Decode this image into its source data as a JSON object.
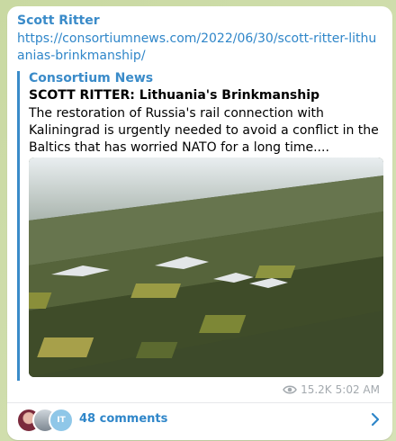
{
  "post": {
    "author": "Scott Ritter",
    "link_text": "https://consortiumnews.com/2022/06/30/scott-ritter-lithuanias-brinkmanship/",
    "preview": {
      "site_name": "Consortium News",
      "title": "SCOTT RITTER: Lithuania's Brinkmanship",
      "description": "The restoration of Russia's rail connection with Kaliningrad is urgently needed to avoid a conflict in the Baltics that has worried NATO for a long time...."
    },
    "views": "15.2K",
    "time": "5:02 AM"
  },
  "comments": {
    "label": "48 comments",
    "avatar3_initials": "IT"
  },
  "icons": {
    "views": "eye-icon",
    "open": "chevron-right-icon"
  },
  "colors": {
    "accent": "#3a8bc9",
    "meta": "#a3a9ae",
    "background": "#cfdcb0"
  }
}
